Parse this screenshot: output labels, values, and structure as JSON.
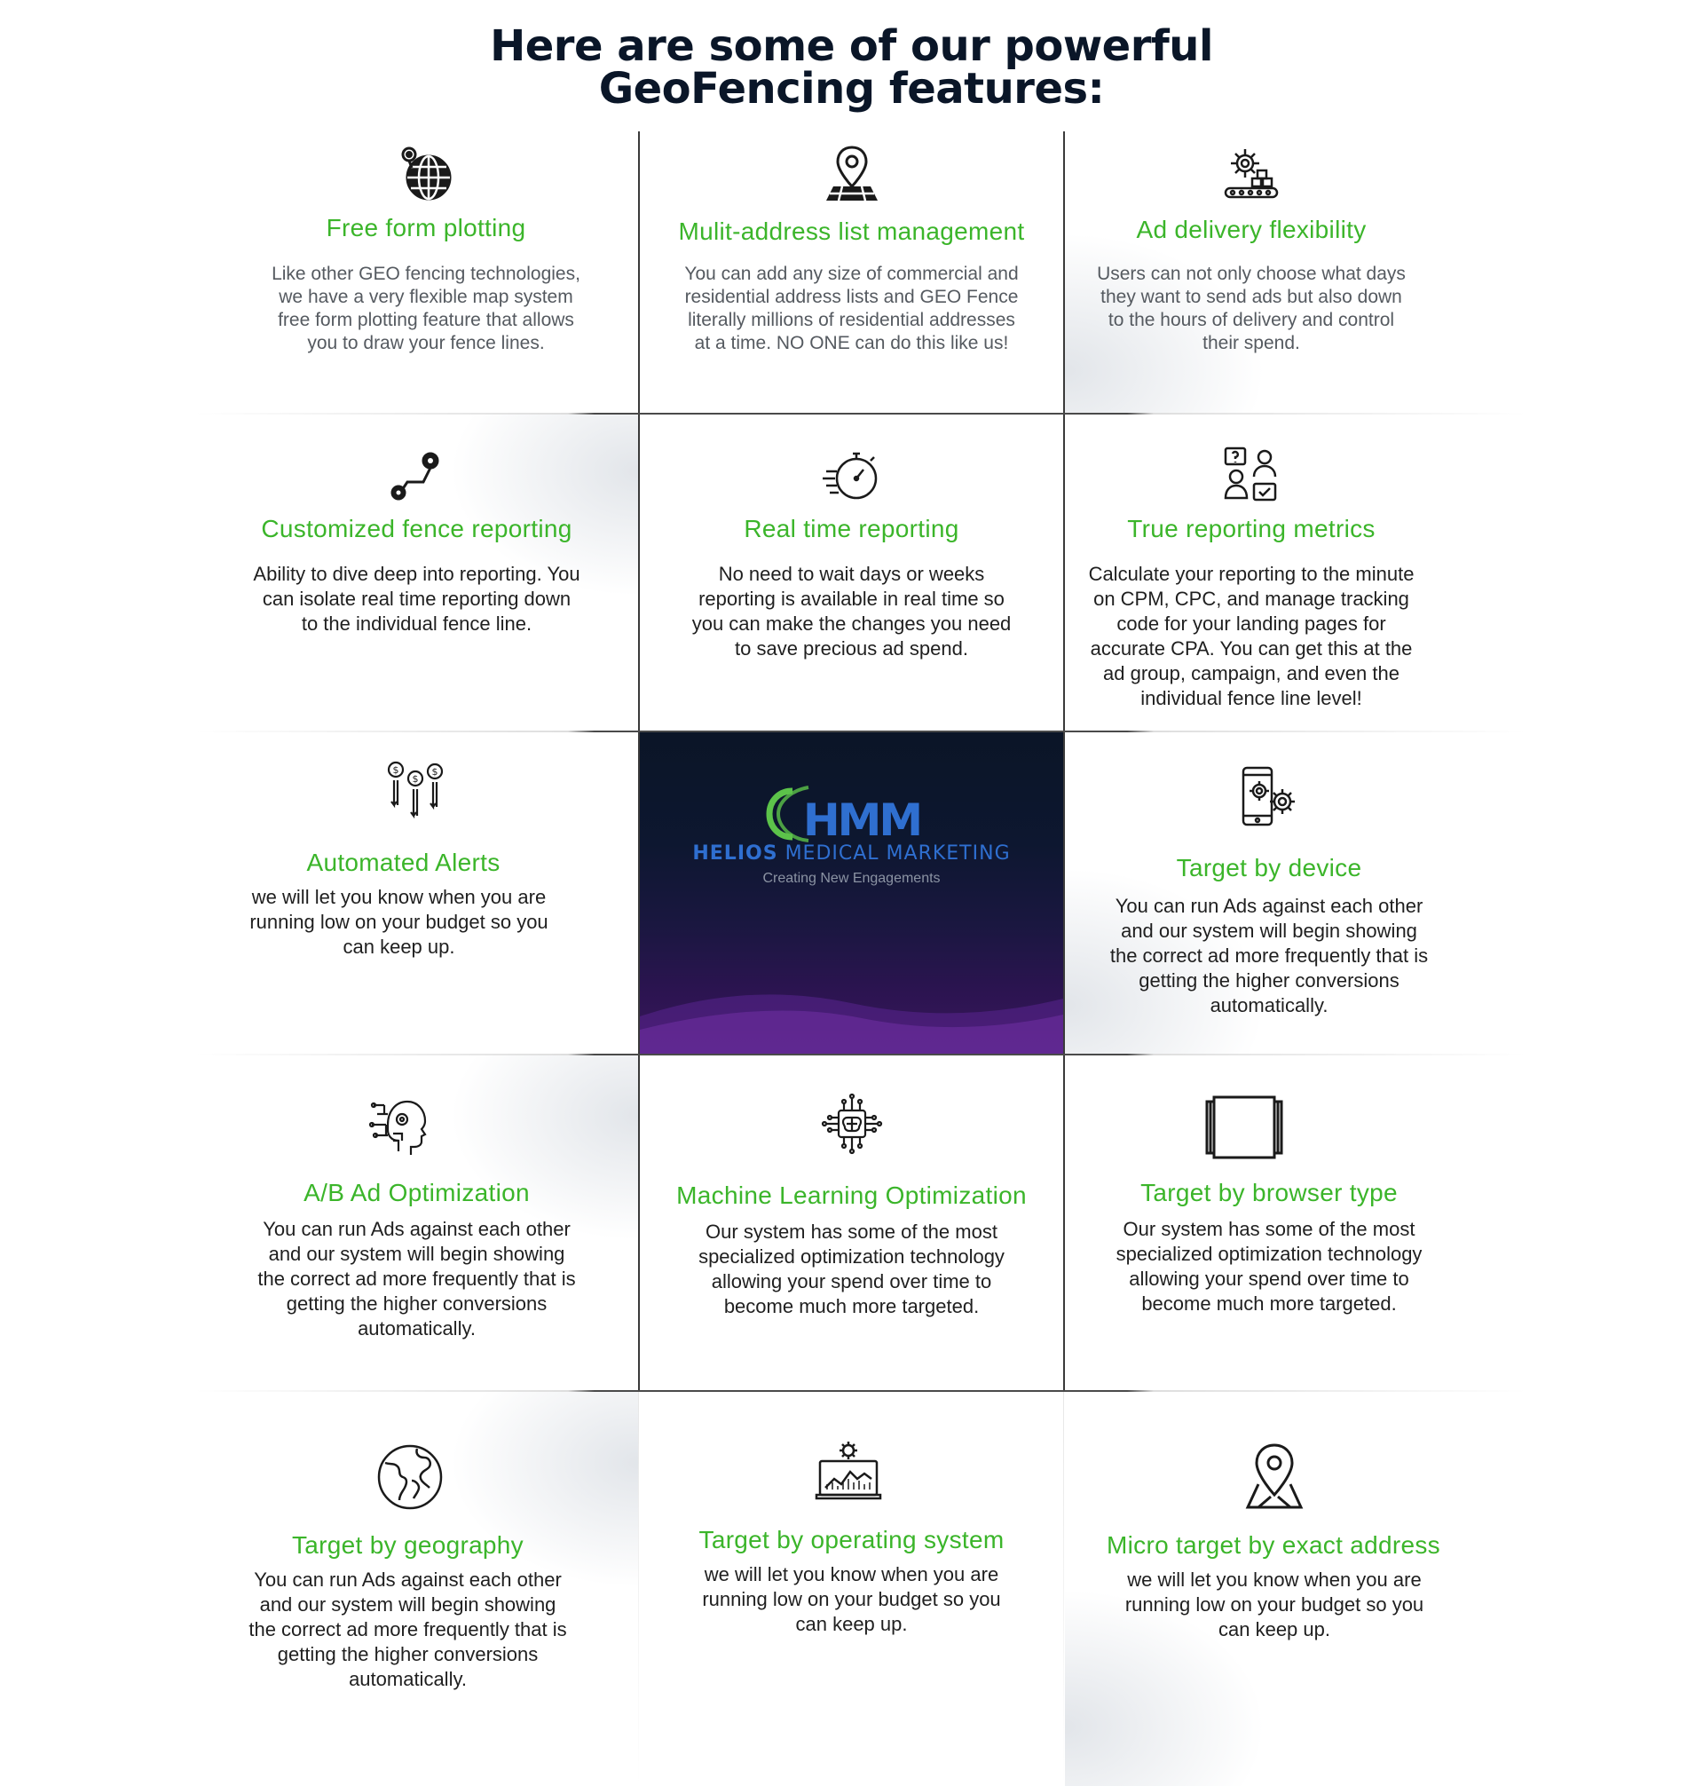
{
  "header": {
    "title_line1": "Here are some of our powerful",
    "title_line2": "GeoFencing features:"
  },
  "brand": {
    "accent_color": "#3bb52a",
    "logo_letters": "HMM",
    "logo_name_bold": "HELIOS",
    "logo_name_rest": "MEDICAL MARKETING",
    "logo_tagline": "Creating New Engagements"
  },
  "features": [
    {
      "icon": "globe-pin-icon",
      "title": "Free form plotting",
      "desc": [
        "Like other GEO fencing technologies,",
        "we have a very flexible map system",
        "free form plotting feature that allows",
        "you to draw your fence lines."
      ]
    },
    {
      "icon": "map-pin-icon",
      "title": "Mulit-address list management",
      "desc": [
        "You can add any size of commercial and",
        "residential address lists and GEO Fence",
        "literally millions of residential addresses",
        "at a time. NO ONE can do this like us!"
      ]
    },
    {
      "icon": "gear-conveyor-icon",
      "title": "Ad delivery flexibility",
      "desc": [
        "Users can not only choose what days",
        "they want to send ads but also down",
        "to the hours of delivery and control",
        "their spend."
      ]
    },
    {
      "icon": "route-icon",
      "title": "Customized fence reporting",
      "desc": [
        "Ability to dive deep into reporting. You",
        "can isolate real time reporting down",
        "to the individual fence line."
      ]
    },
    {
      "icon": "stopwatch-icon",
      "title": "Real time reporting",
      "desc": [
        "No need to wait days or weeks",
        "reporting is available in real time so",
        "you can make the changes you need",
        "to save precious ad spend."
      ]
    },
    {
      "icon": "people-metrics-icon",
      "title": "True reporting metrics",
      "desc": [
        "Calculate your reporting to the minute",
        "on CPM, CPC, and manage tracking",
        "code for your landing pages for",
        "accurate CPA. You can get this at the",
        "ad group, campaign, and even the",
        "individual fence line level!"
      ]
    },
    {
      "icon": "dollar-alerts-icon",
      "title": "Automated Alerts",
      "desc": [
        "we will let you know when you are",
        "running low on your budget so you",
        "can keep up."
      ]
    },
    {
      "icon": "phone-gears-icon",
      "title": "Target by device",
      "desc": [
        "You can run Ads against each other",
        "and our system will begin showing",
        "the correct ad more frequently that is",
        "getting the higher conversions",
        "automatically."
      ]
    },
    {
      "icon": "ai-head-icon",
      "title": "A/B Ad Optimization",
      "desc": [
        "You can run Ads against each other",
        "and our system will begin showing",
        "the correct ad more frequently that is",
        "getting the higher conversions",
        "automatically."
      ]
    },
    {
      "icon": "brain-chip-icon",
      "title": "Machine Learning Optimization",
      "desc": [
        "Our system has some of the most",
        "specialized optimization technology",
        "allowing your spend over time to",
        "become much more targeted."
      ]
    },
    {
      "icon": "browser-window-icon",
      "title": "Target by browser type",
      "desc": [
        "Our system has some of the most",
        "specialized optimization technology",
        "allowing your spend over time to",
        "become much more targeted."
      ]
    },
    {
      "icon": "world-globe-icon",
      "title": "Target by geography",
      "desc": [
        "You can run Ads against each other",
        "and our system will begin showing",
        "the correct ad more frequently that is",
        "getting the higher conversions",
        "automatically."
      ]
    },
    {
      "icon": "laptop-analytics-icon",
      "title": "Target by operating system",
      "desc": [
        "we will let you know when you are",
        "running low on your budget so you",
        "can keep up."
      ]
    },
    {
      "icon": "location-pin-icon",
      "title": "Micro target by exact address",
      "desc": [
        "we will let you know when you are",
        "running low on your budget so you",
        "can keep up."
      ]
    }
  ]
}
